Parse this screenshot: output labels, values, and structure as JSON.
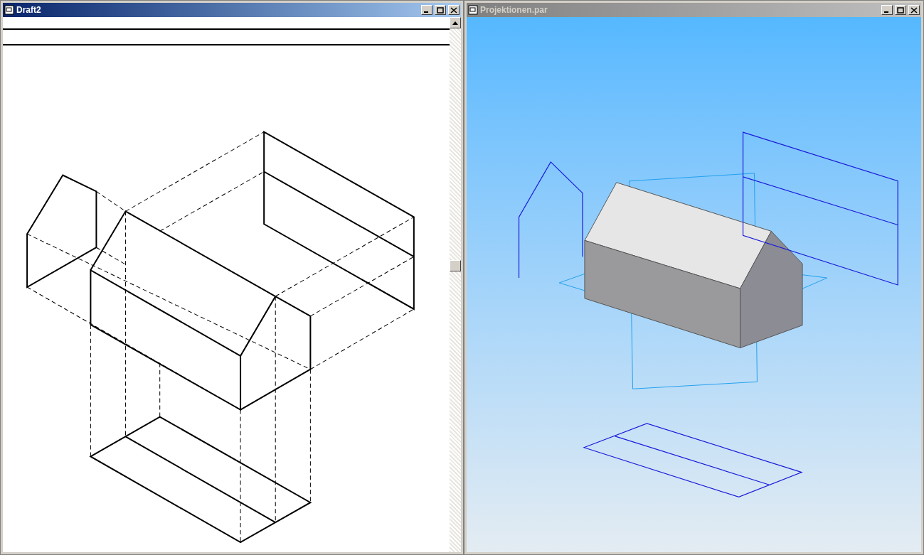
{
  "windows": [
    {
      "title": "Draft2",
      "active": true,
      "kind": "sheet"
    },
    {
      "title": "Projektionen.par",
      "active": false,
      "kind": "model"
    }
  ]
}
